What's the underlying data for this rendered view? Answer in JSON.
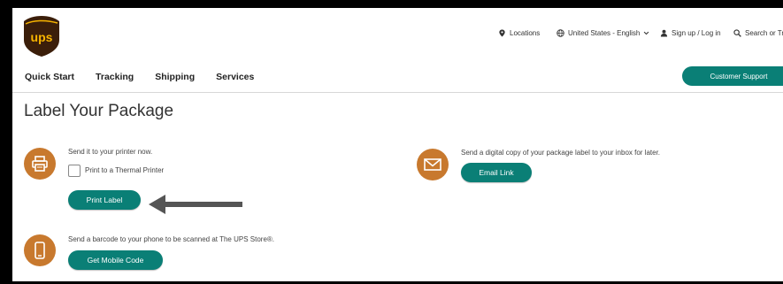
{
  "header": {
    "utility": {
      "locations": "Locations",
      "language": "United States - English",
      "signup": "Sign up / Log in",
      "search": "Search or Tr"
    },
    "nav": [
      "Quick Start",
      "Tracking",
      "Shipping",
      "Services"
    ],
    "support_button": "Customer Support"
  },
  "page": {
    "title": "Label Your Package"
  },
  "options": {
    "print": {
      "description": "Send it to your printer now.",
      "thermal_label": "Print to a Thermal Printer",
      "thermal_checked": false,
      "button": "Print Label"
    },
    "email": {
      "description": "Send a digital copy of your package label to your inbox for later.",
      "button": "Email Link"
    },
    "mobile": {
      "description": "Send a barcode to your phone to be scanned at The UPS Store®.",
      "button": "Get Mobile Code"
    }
  },
  "colors": {
    "accent": "#0a7f76",
    "icon_circle": "#c8792e",
    "logo_brown": "#3b1e0a",
    "logo_gold": "#f7b400"
  },
  "icons": [
    "ups-logo",
    "location-pin-icon",
    "globe-icon",
    "chevron-down-icon",
    "user-icon",
    "search-icon",
    "printer-icon",
    "envelope-icon",
    "mobile-phone-icon",
    "arrow-left-icon"
  ]
}
